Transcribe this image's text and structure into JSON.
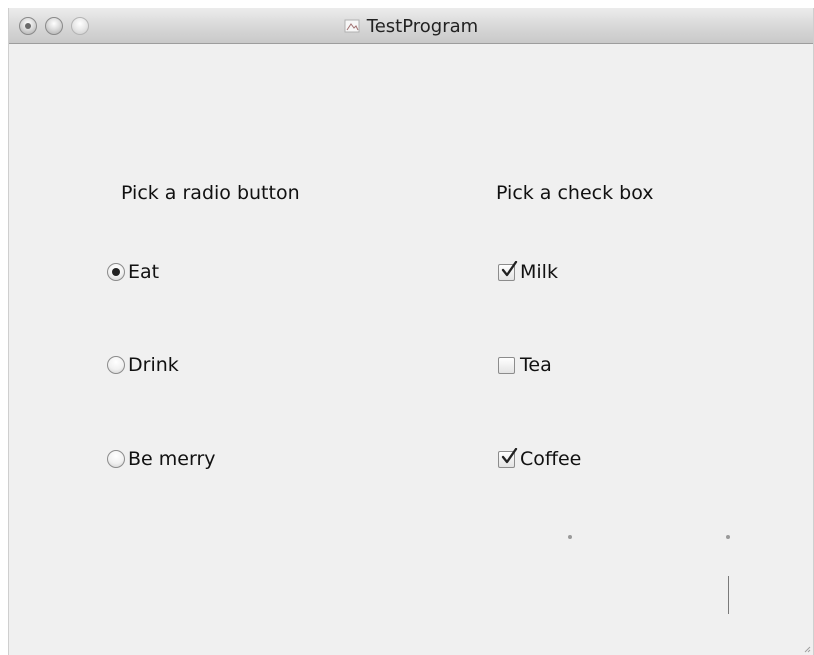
{
  "window": {
    "title": "TestProgram"
  },
  "radio_group": {
    "label": "Pick a radio button",
    "options": [
      {
        "label": "Eat",
        "selected": true
      },
      {
        "label": "Drink",
        "selected": false
      },
      {
        "label": "Be merry",
        "selected": false
      }
    ]
  },
  "checkbox_group": {
    "label": "Pick a check box",
    "options": [
      {
        "label": "Milk",
        "checked": true
      },
      {
        "label": "Tea",
        "checked": false
      },
      {
        "label": "Coffee",
        "checked": true
      }
    ]
  }
}
